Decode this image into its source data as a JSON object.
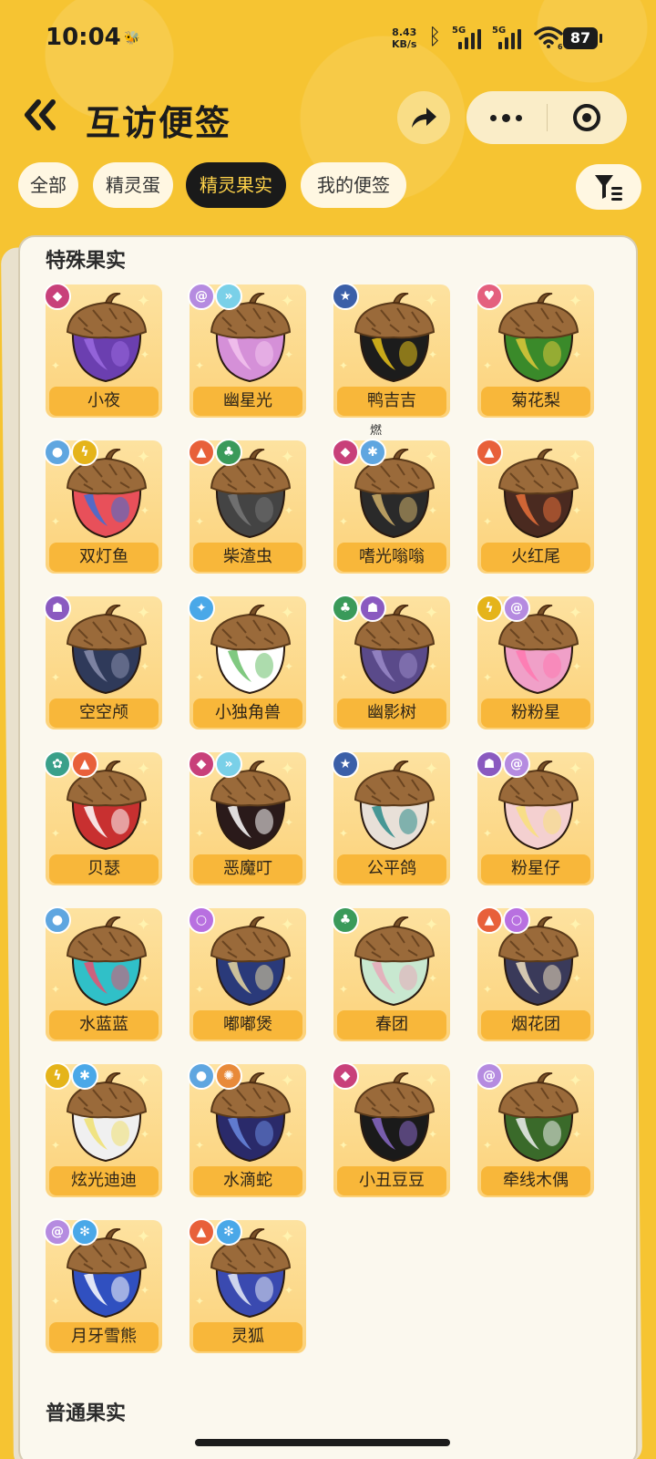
{
  "status_bar": {
    "time": "10:04",
    "net_speed_value": "8.43",
    "net_speed_unit": "KB/s",
    "sim1": "5G",
    "sim2": "5G",
    "wifi_sub": "6",
    "battery": "87"
  },
  "header": {
    "title": "互访便签",
    "back_icon": "double-chevron-left-icon",
    "share_icon": "share-arrow-icon",
    "more_icon": "more-dots-icon",
    "close_icon": "target-circle-icon"
  },
  "tabs": [
    {
      "label": "全部",
      "active": false
    },
    {
      "label": "精灵蛋",
      "active": false
    },
    {
      "label": "精灵果实",
      "active": true
    },
    {
      "label": "我的便签",
      "active": false
    }
  ],
  "filter_icon": "filter-funnel-icon",
  "sections": {
    "special": "特殊果实",
    "normal": "普通果实"
  },
  "colors": {
    "background": "#f6c432",
    "tab_active_bg": "#1a1a1a",
    "tab_active_text": "#ffd34a",
    "label_bg": "#f8b73a"
  },
  "items": [
    {
      "name": "小夜",
      "badges": [
        [
          "#c8407a",
          "demon-icon",
          "◆"
        ]
      ],
      "body": "#6b3fb0",
      "accent": "#9a6ae0"
    },
    {
      "name": "幽星光",
      "badges": [
        [
          "#b58be0",
          "spiral-icon",
          "@"
        ],
        [
          "#7ad0e8",
          "wing-icon",
          "»"
        ]
      ],
      "body": "#d590d8",
      "accent": "#f3c4ef"
    },
    {
      "name": "鸭吉吉",
      "badges": [
        [
          "#3b5fa8",
          "star-icon",
          "★"
        ]
      ],
      "body": "#1c1c1c",
      "accent": "#e8c21a",
      "note": "燃了鸭"
    },
    {
      "name": "菊花梨",
      "badges": [
        [
          "#e4607e",
          "heart-icon",
          "♥"
        ]
      ],
      "body": "#3a8a2a",
      "accent": "#e0c83a"
    },
    {
      "name": "双灯鱼",
      "badges": [
        [
          "#5fa6e0",
          "water-drop-icon",
          "●"
        ],
        [
          "#e5b41a",
          "lightning-icon",
          "ϟ"
        ]
      ],
      "body": "#e8505a",
      "accent": "#3b6fd8"
    },
    {
      "name": "柴渣虫",
      "badges": [
        [
          "#e8603a",
          "fire-icon",
          "▲"
        ],
        [
          "#3a9a5a",
          "leaf-icon",
          "♣"
        ]
      ],
      "body": "#444444",
      "accent": "#777777"
    },
    {
      "name": "嗜光嗡嗡",
      "badges": [
        [
          "#c8407a",
          "demon-icon",
          "◆"
        ],
        [
          "#5fa6e0",
          "ice-icon",
          "✱"
        ]
      ],
      "body": "#2a2a2a",
      "accent": "#d0b06a"
    },
    {
      "name": "火红尾",
      "badges": [
        [
          "#e8603a",
          "fire-icon",
          "▲"
        ]
      ],
      "body": "#4a2a20",
      "accent": "#e8703a"
    },
    {
      "name": "空空颅",
      "badges": [
        [
          "#8a5ac0",
          "ghost-icon",
          "☗"
        ]
      ],
      "body": "#2f3a5a",
      "accent": "#8a8fae"
    },
    {
      "name": "小独角兽",
      "badges": [
        [
          "#4aa8e8",
          "compass-icon",
          "✦"
        ]
      ],
      "body": "#ffffff",
      "accent": "#6ac06a"
    },
    {
      "name": "幽影树",
      "badges": [
        [
          "#3a9a5a",
          "leaf-icon",
          "♣"
        ],
        [
          "#8a5ac0",
          "ghost-icon",
          "☗"
        ]
      ],
      "body": "#5a4a8a",
      "accent": "#9a8ac8"
    },
    {
      "name": "粉粉星",
      "badges": [
        [
          "#e5b41a",
          "lightning-icon",
          "ϟ"
        ],
        [
          "#b58be0",
          "spiral-icon",
          "@"
        ]
      ],
      "body": "#f0a0c8",
      "accent": "#ff78b0"
    },
    {
      "name": "贝瑟",
      "badges": [
        [
          "#3aa08a",
          "gear-icon",
          "✿"
        ],
        [
          "#e8603a",
          "fire-icon",
          "▲"
        ]
      ],
      "body": "#c83030",
      "accent": "#ffffff"
    },
    {
      "name": "恶魔叮",
      "badges": [
        [
          "#c8407a",
          "demon-icon",
          "◆"
        ],
        [
          "#7ad0e8",
          "wing-icon",
          "»"
        ]
      ],
      "body": "#2a1a1a",
      "accent": "#ffffff"
    },
    {
      "name": "公平鸽",
      "badges": [
        [
          "#3b5fa8",
          "star-icon",
          "★"
        ]
      ],
      "body": "#e8e0d8",
      "accent": "#2a8a8a"
    },
    {
      "name": "粉星仔",
      "badges": [
        [
          "#8a5ac0",
          "ghost-icon",
          "☗"
        ],
        [
          "#b58be0",
          "spiral-icon",
          "@"
        ]
      ],
      "body": "#f4d0d0",
      "accent": "#f8e07a"
    },
    {
      "name": "水蓝蓝",
      "badges": [
        [
          "#5fa6e0",
          "water-drop-icon",
          "●"
        ]
      ],
      "body": "#30c0c8",
      "accent": "#e85070"
    },
    {
      "name": "嘟嘟煲",
      "badges": [
        [
          "#b870e0",
          "bubble-icon",
          "○"
        ]
      ],
      "body": "#2a3a7a",
      "accent": "#e8d8a0"
    },
    {
      "name": "春团",
      "badges": [
        [
          "#3a9a5a",
          "leaf-icon",
          "♣"
        ]
      ],
      "body": "#c8e8d0",
      "accent": "#e8a8b8"
    },
    {
      "name": "烟花团",
      "badges": [
        [
          "#e8603a",
          "fire-icon",
          "▲"
        ],
        [
          "#b870e0",
          "bubble-icon",
          "○"
        ]
      ],
      "body": "#3a3a5a",
      "accent": "#f0e0c0"
    },
    {
      "name": "炫光迪迪",
      "badges": [
        [
          "#e5b41a",
          "lightning-icon",
          "ϟ"
        ],
        [
          "#4aa8e8",
          "ice-icon",
          "✱"
        ]
      ],
      "body": "#f0f0f0",
      "accent": "#f0e070"
    },
    {
      "name": "水滴蛇",
      "badges": [
        [
          "#5fa6e0",
          "water-drop-icon",
          "●"
        ],
        [
          "#e88a3a",
          "sun-icon",
          "✺"
        ]
      ],
      "body": "#2a2a6a",
      "accent": "#6a8ae0"
    },
    {
      "name": "小丑豆豆",
      "badges": [
        [
          "#c8407a",
          "demon-icon",
          "◆"
        ]
      ],
      "body": "#1a1a1a",
      "accent": "#8a6ac8"
    },
    {
      "name": "牵线木偶",
      "badges": [
        [
          "#b58be0",
          "spiral-icon",
          "@"
        ]
      ],
      "body": "#3a6a2a",
      "accent": "#f0f0f0"
    },
    {
      "name": "月牙雪熊",
      "badges": [
        [
          "#b58be0",
          "spiral-icon",
          "@"
        ],
        [
          "#4aa8e8",
          "snowflake-icon",
          "✻"
        ]
      ],
      "body": "#3050c0",
      "accent": "#ffffff"
    },
    {
      "name": "灵狐",
      "badges": [
        [
          "#e8603a",
          "fire-icon",
          "▲"
        ],
        [
          "#4aa8e8",
          "snowflake-icon",
          "✻"
        ]
      ],
      "body": "#3a4ab0",
      "accent": "#e8ecf8"
    }
  ]
}
